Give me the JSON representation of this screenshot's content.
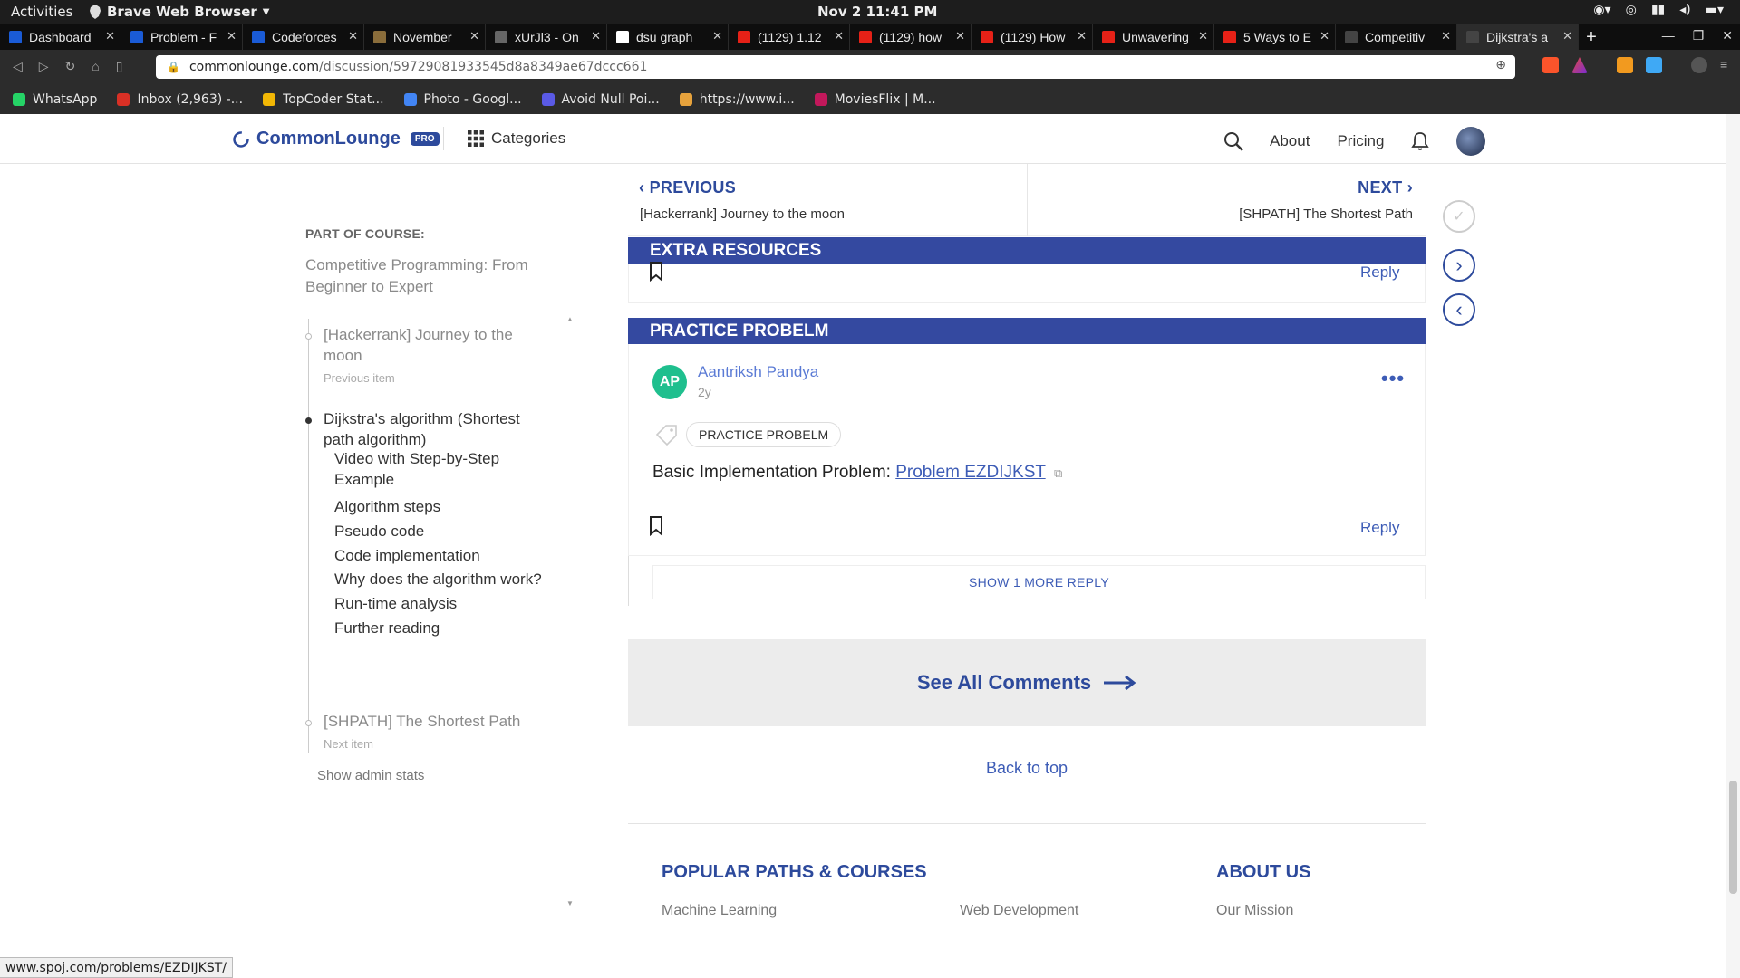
{
  "os": {
    "activities": "Activities",
    "app_name": "Brave Web Browser",
    "clock": "Nov 2  11:41 PM"
  },
  "browser": {
    "tabs": [
      {
        "title": "Dashboard",
        "color": "#1a5bd6"
      },
      {
        "title": "Problem - F",
        "color": "#1a5bd6"
      },
      {
        "title": "Codeforces",
        "color": "#1a5bd6"
      },
      {
        "title": "November",
        "color": "#8a6d3b"
      },
      {
        "title": "xUrJl3 - On",
        "color": "#666666"
      },
      {
        "title": "dsu graph",
        "color": "#ffffff"
      },
      {
        "title": "(1129) 1.12",
        "color": "#e62117"
      },
      {
        "title": "(1129) how",
        "color": "#e62117"
      },
      {
        "title": "(1129) How",
        "color": "#e62117"
      },
      {
        "title": "Unwavering",
        "color": "#e62117"
      },
      {
        "title": "5 Ways to E",
        "color": "#e62117"
      },
      {
        "title": "Competitiv",
        "color": "#444444"
      },
      {
        "title": "Dijkstra's a",
        "color": "#444444"
      }
    ],
    "url_domain": "commonlounge.com",
    "url_path": "/discussion/59729081933545d8a8349ae67dccc661",
    "bookmarks": [
      {
        "label": "WhatsApp",
        "color": "#25d366"
      },
      {
        "label": "Inbox (2,963) -...",
        "color": "#d93025"
      },
      {
        "label": "TopCoder Stat...",
        "color": "#f2b705"
      },
      {
        "label": "Photo - Googl...",
        "color": "#4285f4"
      },
      {
        "label": "Avoid Null Poi...",
        "color": "#5a5ae6"
      },
      {
        "label": "https://www.i...",
        "color": "#e6a23c"
      },
      {
        "label": "MoviesFlix | M...",
        "color": "#c2185b"
      }
    ],
    "status_url": "www.spoj.com/problems/EZDIJKST/"
  },
  "site": {
    "logo_text": "CommonLounge",
    "logo_badge": "PRO",
    "categories_label": "Categories",
    "about_label": "About",
    "pricing_label": "Pricing",
    "accent": "#2d4a9c"
  },
  "sidebar": {
    "part_of_course_label": "PART OF COURSE:",
    "course_title": "Competitive Programming: From Beginner to Expert",
    "previous_item": {
      "title": "[Hackerrank] Journey to the moon",
      "hint": "Previous item"
    },
    "current_item": "Dijkstra's algorithm (Shortest path algorithm)",
    "sections": [
      "Video with Step-by-Step Example",
      "Algorithm steps",
      "Pseudo code",
      "Code implementation",
      "Why does the algorithm work?",
      "Run-time analysis",
      "Further reading"
    ],
    "next_item": {
      "title": "[SHPATH] The Shortest Path",
      "hint": "Next item"
    },
    "admin_stats": "Show admin stats"
  },
  "prevnext": {
    "previous_label": "PREVIOUS",
    "previous_title": "[Hackerrank] Journey to the moon",
    "next_label": "NEXT",
    "next_title": "[SHPATH] The Shortest Path"
  },
  "extra_resources": {
    "heading": "EXTRA RESOURCES",
    "reply_label": "Reply"
  },
  "practice": {
    "heading": "PRACTICE PROBELM",
    "avatar_initials": "AP",
    "author": "Aantriksh Pandya",
    "time": "2y",
    "tag": "PRACTICE PROBELM",
    "body_prefix": "Basic Implementation Problem: ",
    "link_text": "Problem EZDIJKST",
    "reply_label": "Reply",
    "show_more": "SHOW 1 MORE REPLY"
  },
  "see_all": "See All Comments",
  "back_to_top": "Back to top",
  "footer": {
    "col1_heading": "POPULAR PATHS & COURSES",
    "col1_link1": "Machine Learning",
    "col1_link2": "Web Development",
    "col2_heading": "ABOUT US",
    "col2_link1": "Our Mission"
  }
}
